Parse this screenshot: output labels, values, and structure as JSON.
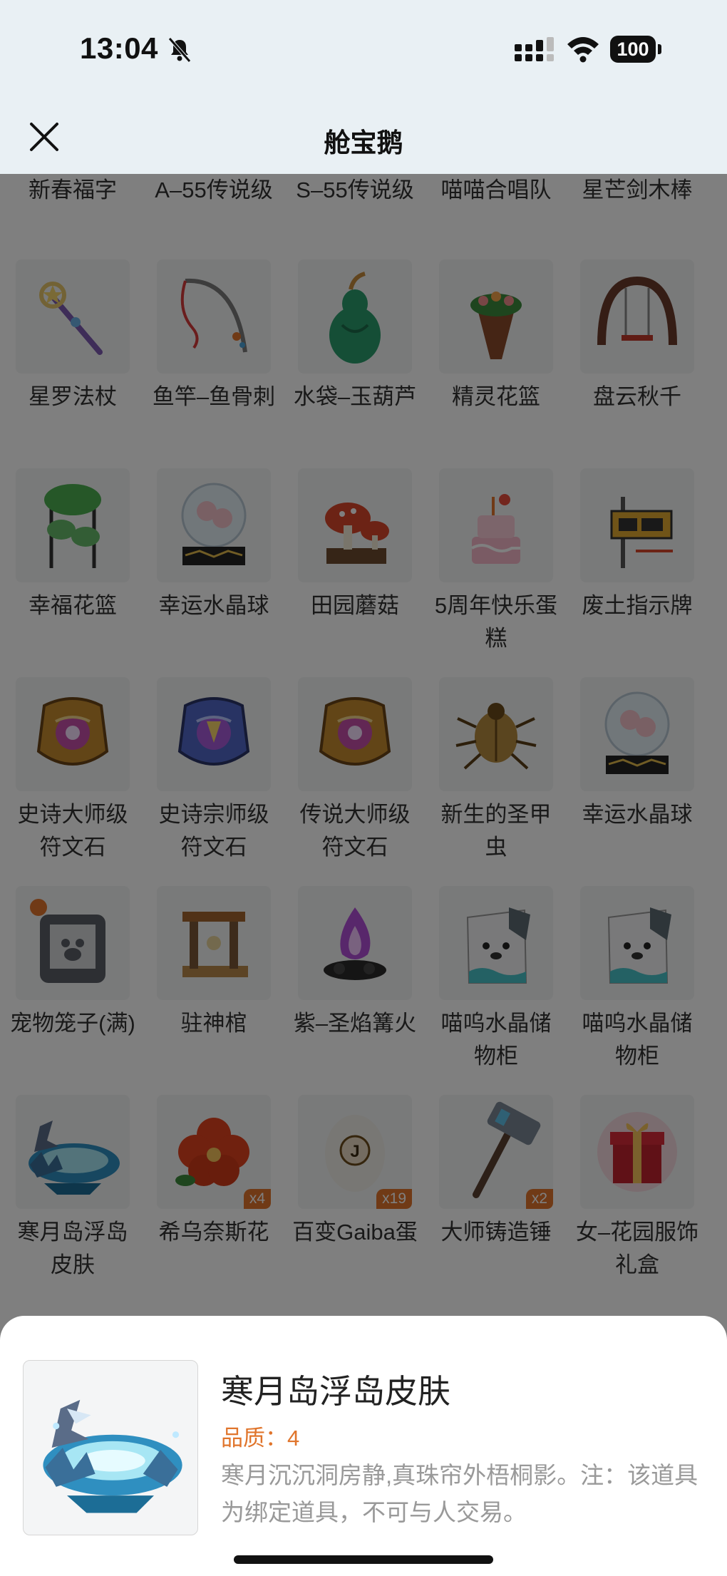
{
  "status_bar": {
    "time": "13:04",
    "battery": "100"
  },
  "nav": {
    "title": "舱宝鹅"
  },
  "grid": {
    "top_row_partial": [
      "新春福字",
      "A–55传说级",
      "S–55传说级",
      "喵喵合唱队",
      "星芒剑木棒"
    ],
    "items": [
      {
        "label": "星罗法杖",
        "icon": "star-staff-icon",
        "badge": ""
      },
      {
        "label": "鱼竿–鱼骨刺",
        "icon": "fishing-rod-icon",
        "badge": ""
      },
      {
        "label": "水袋–玉葫芦",
        "icon": "gourd-icon",
        "badge": ""
      },
      {
        "label": "精灵花篮",
        "icon": "flower-basket-icon",
        "badge": ""
      },
      {
        "label": "盘云秋千",
        "icon": "swing-icon",
        "badge": ""
      },
      {
        "label": "幸福花篮",
        "icon": "plant-stand-icon",
        "badge": ""
      },
      {
        "label": "幸运水晶球",
        "icon": "crystal-ball-icon",
        "badge": ""
      },
      {
        "label": "田园蘑菇",
        "icon": "mushroom-icon",
        "badge": ""
      },
      {
        "label": "5周年快乐蛋糕",
        "icon": "cake-icon",
        "badge": ""
      },
      {
        "label": "废土指示牌",
        "icon": "sign-icon",
        "badge": ""
      },
      {
        "label": "史诗大师级符文石",
        "icon": "rune-stone-icon",
        "badge": ""
      },
      {
        "label": "史诗宗师级符文石",
        "icon": "rune-stone-blue-icon",
        "badge": ""
      },
      {
        "label": "传说大师级符文石",
        "icon": "rune-stone-icon",
        "badge": ""
      },
      {
        "label": "新生的圣甲虫",
        "icon": "scarab-icon",
        "badge": ""
      },
      {
        "label": "幸运水晶球",
        "icon": "crystal-ball-icon",
        "badge": ""
      },
      {
        "label": "宠物笼子(满)",
        "icon": "pet-cage-icon",
        "badge": ""
      },
      {
        "label": "驻神棺",
        "icon": "shrine-gate-icon",
        "badge": ""
      },
      {
        "label": "紫–圣焰篝火",
        "icon": "bonfire-icon",
        "badge": ""
      },
      {
        "label": "喵呜水晶储物柜",
        "icon": "cat-locker-icon",
        "badge": ""
      },
      {
        "label": "喵呜水晶储物柜",
        "icon": "cat-locker-icon",
        "badge": ""
      },
      {
        "label": "寒月岛浮岛皮肤",
        "icon": "floating-island-icon",
        "badge": ""
      },
      {
        "label": "希乌奈斯花",
        "icon": "red-flower-icon",
        "badge": "x4"
      },
      {
        "label": "百变Gaiba蛋",
        "icon": "egg-icon",
        "badge": "x19"
      },
      {
        "label": "大师铸造锤",
        "icon": "hammer-icon",
        "badge": "x2"
      },
      {
        "label": "女–花园服饰礼盒",
        "icon": "gift-box-icon",
        "badge": ""
      }
    ]
  },
  "detail": {
    "name": "寒月岛浮岛皮肤",
    "quality": "品质：4",
    "description": "寒月沉沉洞房静,真珠帘外梧桐影。注：该道具为绑定道具，不可与人交易。",
    "icon": "floating-island-icon"
  },
  "colors": {
    "accent": "#e0752c",
    "header_bg": "#e9f0f4",
    "overlay": "rgba(0,0,0,0.5)"
  }
}
